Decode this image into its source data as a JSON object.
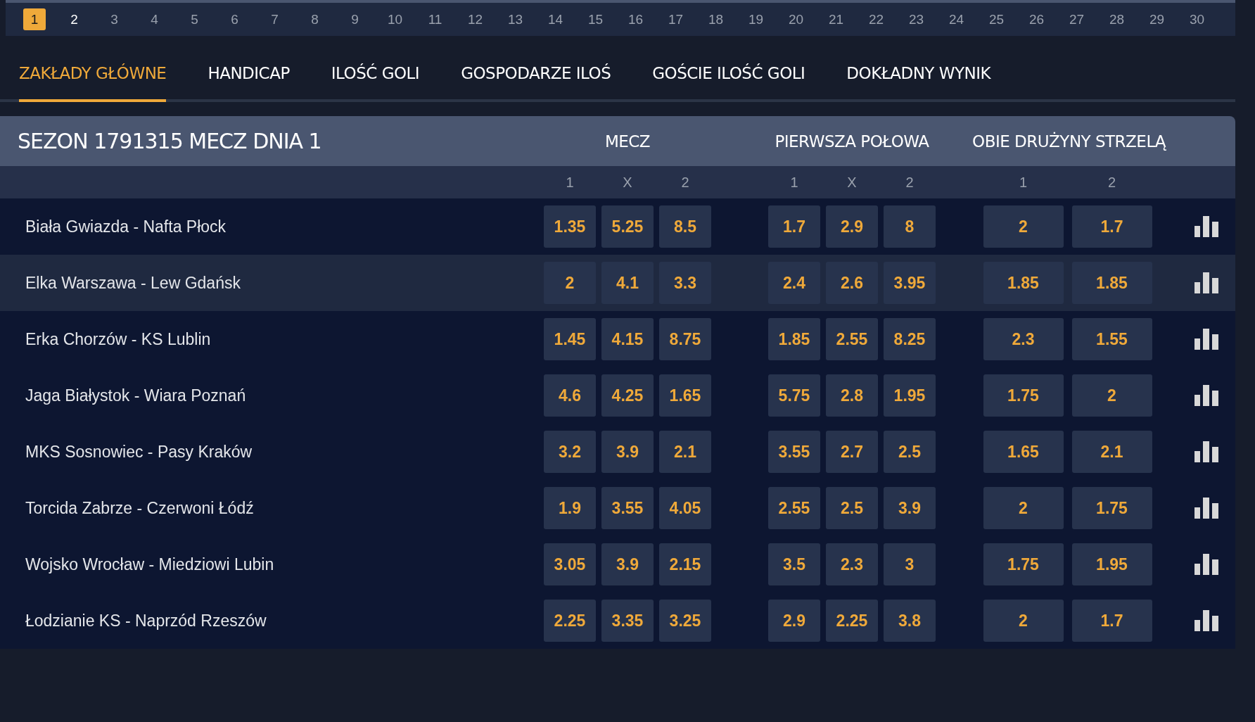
{
  "days": [
    {
      "label": "1",
      "selected": true,
      "current": false
    },
    {
      "label": "2",
      "selected": false,
      "current": true
    },
    {
      "label": "3",
      "selected": false,
      "current": false
    },
    {
      "label": "4",
      "selected": false,
      "current": false
    },
    {
      "label": "5",
      "selected": false,
      "current": false
    },
    {
      "label": "6",
      "selected": false,
      "current": false
    },
    {
      "label": "7",
      "selected": false,
      "current": false
    },
    {
      "label": "8",
      "selected": false,
      "current": false
    },
    {
      "label": "9",
      "selected": false,
      "current": false
    },
    {
      "label": "10",
      "selected": false,
      "current": false
    },
    {
      "label": "11",
      "selected": false,
      "current": false
    },
    {
      "label": "12",
      "selected": false,
      "current": false
    },
    {
      "label": "13",
      "selected": false,
      "current": false
    },
    {
      "label": "14",
      "selected": false,
      "current": false
    },
    {
      "label": "15",
      "selected": false,
      "current": false
    },
    {
      "label": "16",
      "selected": false,
      "current": false
    },
    {
      "label": "17",
      "selected": false,
      "current": false
    },
    {
      "label": "18",
      "selected": false,
      "current": false
    },
    {
      "label": "19",
      "selected": false,
      "current": false
    },
    {
      "label": "20",
      "selected": false,
      "current": false
    },
    {
      "label": "21",
      "selected": false,
      "current": false
    },
    {
      "label": "22",
      "selected": false,
      "current": false
    },
    {
      "label": "23",
      "selected": false,
      "current": false
    },
    {
      "label": "24",
      "selected": false,
      "current": false
    },
    {
      "label": "25",
      "selected": false,
      "current": false
    },
    {
      "label": "26",
      "selected": false,
      "current": false
    },
    {
      "label": "27",
      "selected": false,
      "current": false
    },
    {
      "label": "28",
      "selected": false,
      "current": false
    },
    {
      "label": "29",
      "selected": false,
      "current": false
    },
    {
      "label": "30",
      "selected": false,
      "current": false
    }
  ],
  "tabs": [
    {
      "label": "ZAKŁADY GŁÓWNE",
      "selected": true
    },
    {
      "label": "HANDICAP",
      "selected": false
    },
    {
      "label": "ILOŚĆ GOLI",
      "selected": false
    },
    {
      "label": "GOSPODARZE ILOŚ",
      "selected": false
    },
    {
      "label": "GOŚCIE ILOŚĆ GOLI",
      "selected": false
    },
    {
      "label": "DOKŁADNY WYNIK",
      "selected": false
    }
  ],
  "table": {
    "title": "SEZON 1791315 MECZ DNIA 1",
    "groups": [
      {
        "title": "MECZ",
        "columns": [
          "1",
          "X",
          "2"
        ]
      },
      {
        "title": "PIERWSZA POŁOWA",
        "columns": [
          "1",
          "X",
          "2"
        ]
      },
      {
        "title": "OBIE DRUŻYNY STRZELĄ",
        "columns": [
          "1",
          "2"
        ]
      }
    ],
    "rows": [
      {
        "match": "Biała Gwiazda - Nafta Płock",
        "highlighted": false,
        "odds": [
          [
            "1.35",
            "5.25",
            "8.5"
          ],
          [
            "1.7",
            "2.9",
            "8"
          ],
          [
            "2",
            "1.7"
          ]
        ]
      },
      {
        "match": "Elka Warszawa - Lew Gdańsk",
        "highlighted": true,
        "odds": [
          [
            "2",
            "4.1",
            "3.3"
          ],
          [
            "2.4",
            "2.6",
            "3.95"
          ],
          [
            "1.85",
            "1.85"
          ]
        ]
      },
      {
        "match": "Erka Chorzów - KS Lublin",
        "highlighted": false,
        "odds": [
          [
            "1.45",
            "4.15",
            "8.75"
          ],
          [
            "1.85",
            "2.55",
            "8.25"
          ],
          [
            "2.3",
            "1.55"
          ]
        ]
      },
      {
        "match": "Jaga Białystok - Wiara Poznań",
        "highlighted": false,
        "odds": [
          [
            "4.6",
            "4.25",
            "1.65"
          ],
          [
            "5.75",
            "2.8",
            "1.95"
          ],
          [
            "1.75",
            "2"
          ]
        ]
      },
      {
        "match": "MKS Sosnowiec - Pasy Kraków",
        "highlighted": false,
        "odds": [
          [
            "3.2",
            "3.9",
            "2.1"
          ],
          [
            "3.55",
            "2.7",
            "2.5"
          ],
          [
            "1.65",
            "2.1"
          ]
        ]
      },
      {
        "match": "Torcida Zabrze - Czerwoni Łódź",
        "highlighted": false,
        "odds": [
          [
            "1.9",
            "3.55",
            "4.05"
          ],
          [
            "2.55",
            "2.5",
            "3.9"
          ],
          [
            "2",
            "1.75"
          ]
        ]
      },
      {
        "match": "Wojsko Wrocław - Miedziowi Lubin",
        "highlighted": false,
        "odds": [
          [
            "3.05",
            "3.9",
            "2.15"
          ],
          [
            "3.5",
            "2.3",
            "3"
          ],
          [
            "1.75",
            "1.95"
          ]
        ]
      },
      {
        "match": "Łodzianie KS - Naprzód Rzeszów",
        "highlighted": false,
        "odds": [
          [
            "2.25",
            "3.35",
            "3.25"
          ],
          [
            "2.9",
            "2.25",
            "3.8"
          ],
          [
            "2",
            "1.7"
          ]
        ]
      }
    ]
  }
}
